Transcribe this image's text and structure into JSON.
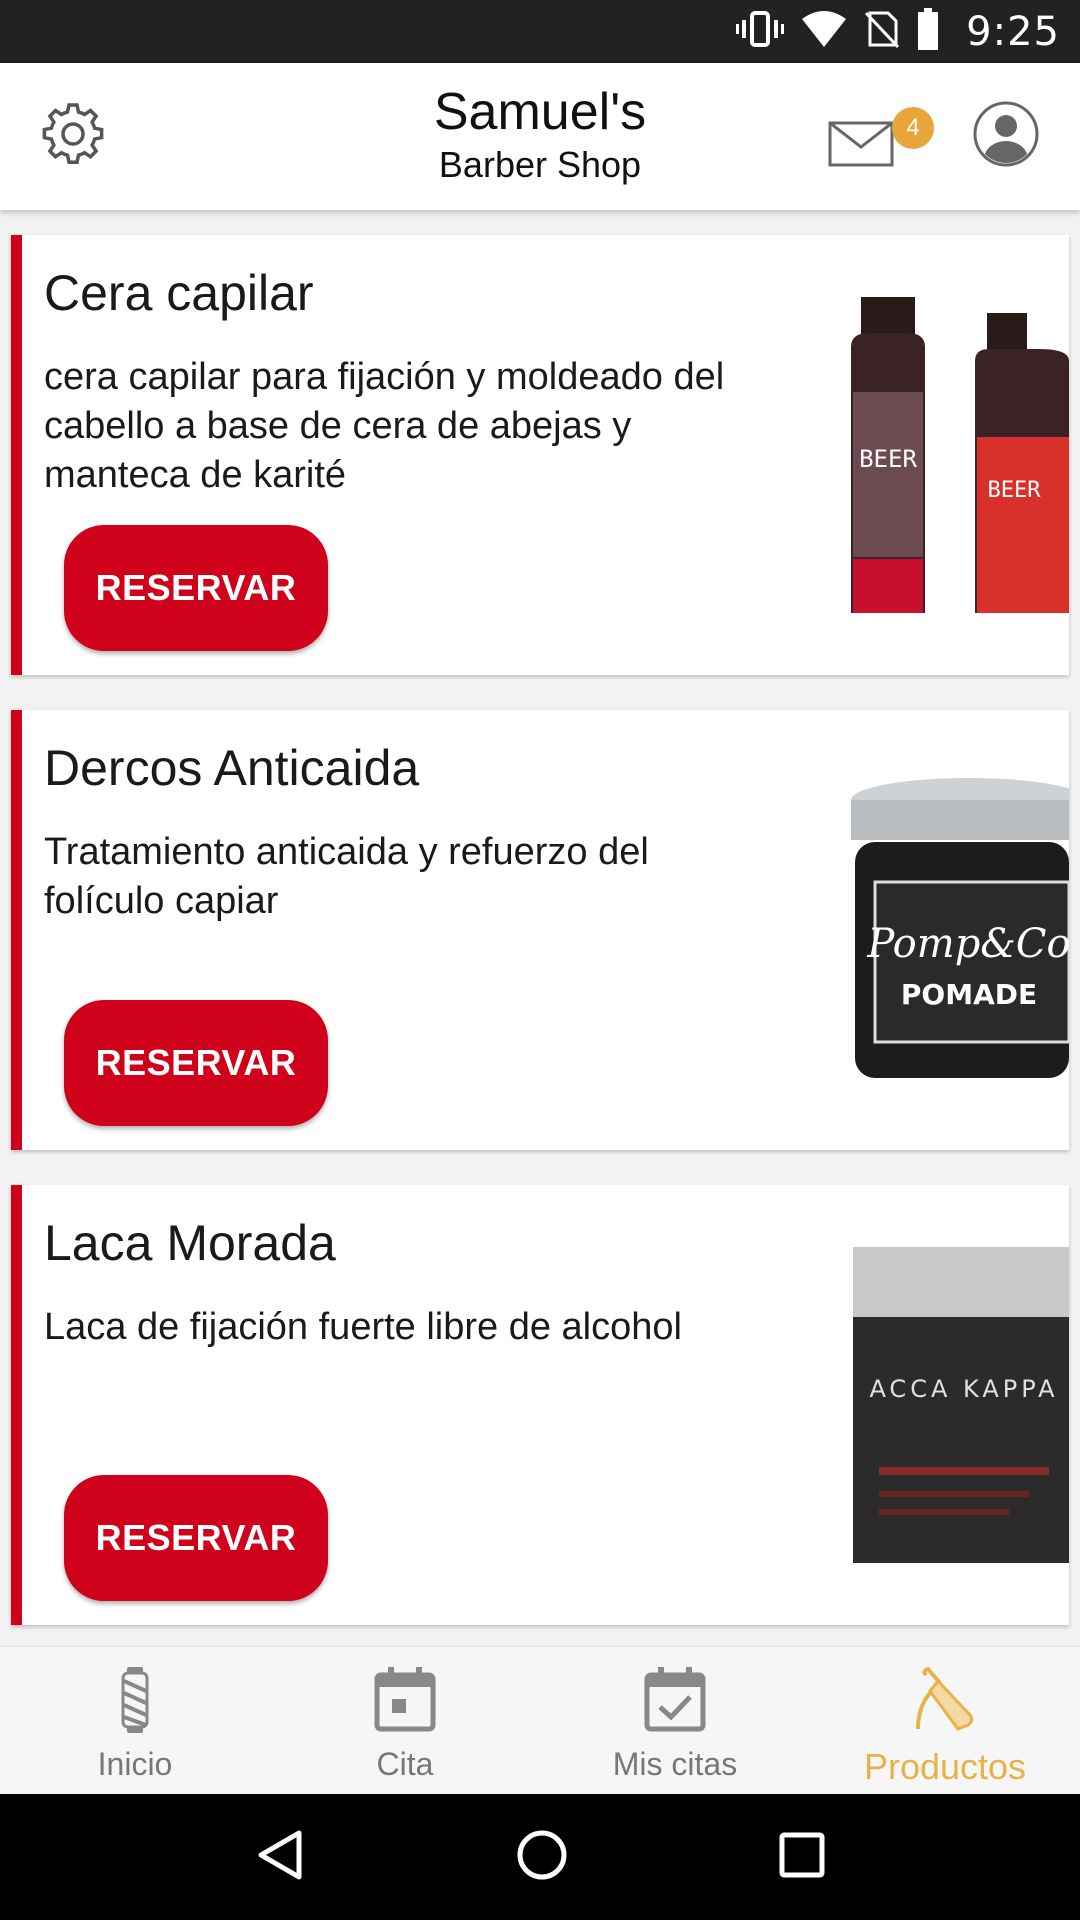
{
  "status_bar": {
    "time": "9:25",
    "icons": [
      "vibrate-icon",
      "wifi-icon",
      "no-sim-icon",
      "battery-icon"
    ]
  },
  "header": {
    "title": "Samuel's",
    "subtitle": "Barber Shop",
    "settings_icon": "gear-icon",
    "mail_icon": "mail-icon",
    "mail_badge": "4",
    "profile_icon": "profile-icon"
  },
  "products": [
    {
      "name": "Cera capilar",
      "description": "cera capilar para fijación y moldeado del cabello a base de cera de abejas y manteca de karité",
      "button": "RESERVAR"
    },
    {
      "name": "Dercos Anticaida",
      "description": "Tratamiento anticaida y refuerzo del folículo capiar",
      "button": "RESERVAR"
    },
    {
      "name": "Laca Morada",
      "description": "Laca de fijación fuerte libre de alcohol",
      "button": "RESERVAR"
    }
  ],
  "bottom_nav": [
    {
      "label": "Inicio",
      "icon": "barber-pole-icon",
      "active": false
    },
    {
      "label": "Cita",
      "icon": "calendar-icon",
      "active": false
    },
    {
      "label": "Mis citas",
      "icon": "calendar-check-icon",
      "active": true
    },
    {
      "label": "Productos",
      "icon": "razor-icon",
      "active": true
    }
  ],
  "colors": {
    "accent": "#d0021b",
    "active_tab": "#e8b24a",
    "badge": "#e8a63a"
  },
  "system_nav": [
    "back-icon",
    "home-icon",
    "recents-icon"
  ]
}
